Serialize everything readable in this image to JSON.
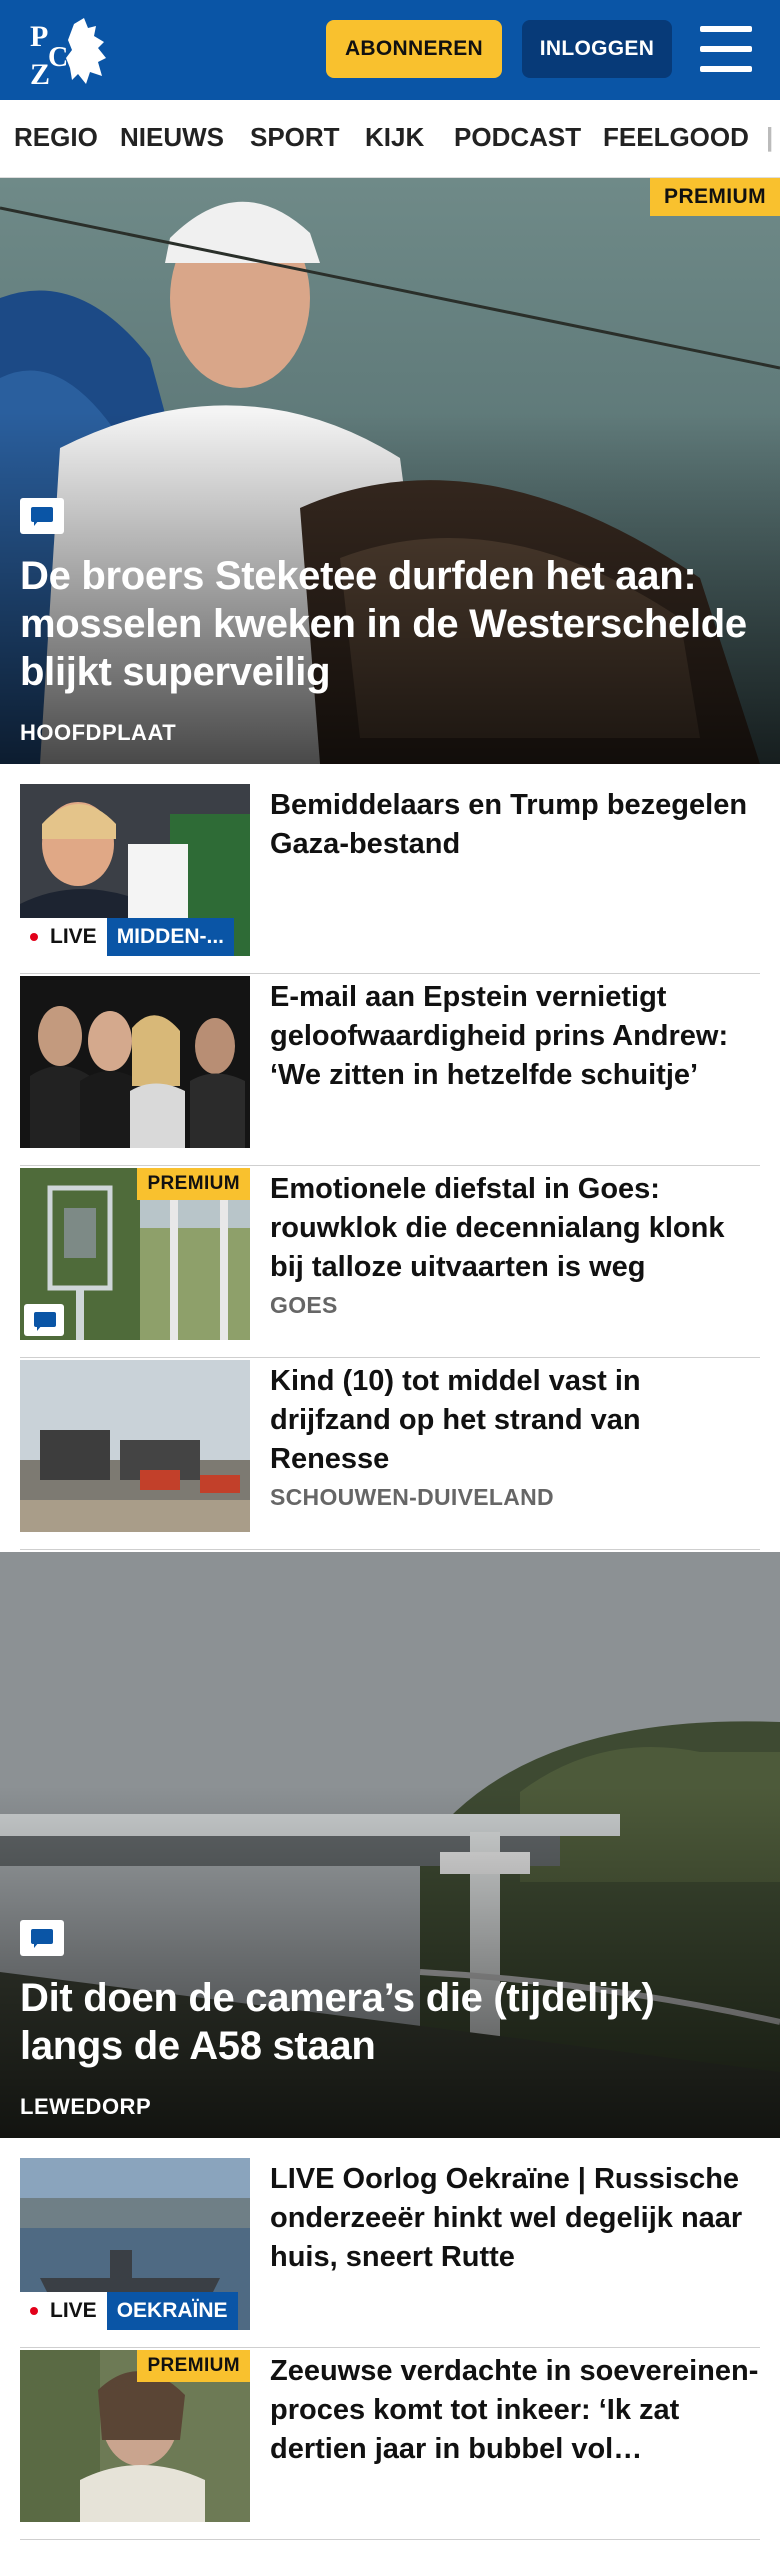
{
  "header": {
    "brand": "PZC",
    "subscribe_label": "ABONNEREN",
    "login_label": "INLOGGEN"
  },
  "nav": {
    "items": [
      "REGIO",
      "NIEUWS",
      "SPORT",
      "KIJK",
      "PODCAST",
      "FEELGOOD"
    ]
  },
  "hero1": {
    "premium_label": "PREMIUM",
    "title": "De broers Steketee durfden het aan: mosselen kweken in de Westerschel­de blijkt superveilig",
    "location": "HOOFDPLAAT"
  },
  "articles1": [
    {
      "title": "Bemiddelaars en Trump bezegelen Gaza-bestand",
      "live_label": "LIVE",
      "live_topic": "MIDDEN-..."
    },
    {
      "title": "E-mail aan Epstein vernietigt geloofwaardigheid prins Andrew: ‘We zitten in hetzelfde schuitje’"
    },
    {
      "title": "Emotionele diefstal in Goes: rouwklok die decennialang klonk bij talloze uitvaarten is weg",
      "location": "GOES",
      "premium_label": "PREMIUM"
    },
    {
      "title": "Kind (10) tot middel vast in drijfzand op het strand van Renesse",
      "location": "SCHOUWEN-DUIVELAND"
    }
  ],
  "hero2": {
    "title": "Dit doen de camera’s die (tijdelijk) langs de A58 staan",
    "location": "LEWEDORP"
  },
  "articles2": [
    {
      "title": "LIVE Oorlog Oekraïne | Russische onderzeeër hinkt wel degelijk naar huis, sneert Rutte",
      "live_label": "LIVE",
      "live_topic": "OEKRAÏNE"
    },
    {
      "title": "Zeeuwse verdachte in soeverei­nen-proces komt tot inkeer: ‘Ik zat dertien jaar in bubbel vol…",
      "premium_label": "PREMIUM"
    }
  ],
  "colors": {
    "brand_blue": "#0a55a6",
    "dark_blue": "#073a78",
    "premium_yellow": "#f9c12e",
    "live_red": "#e2001a"
  }
}
